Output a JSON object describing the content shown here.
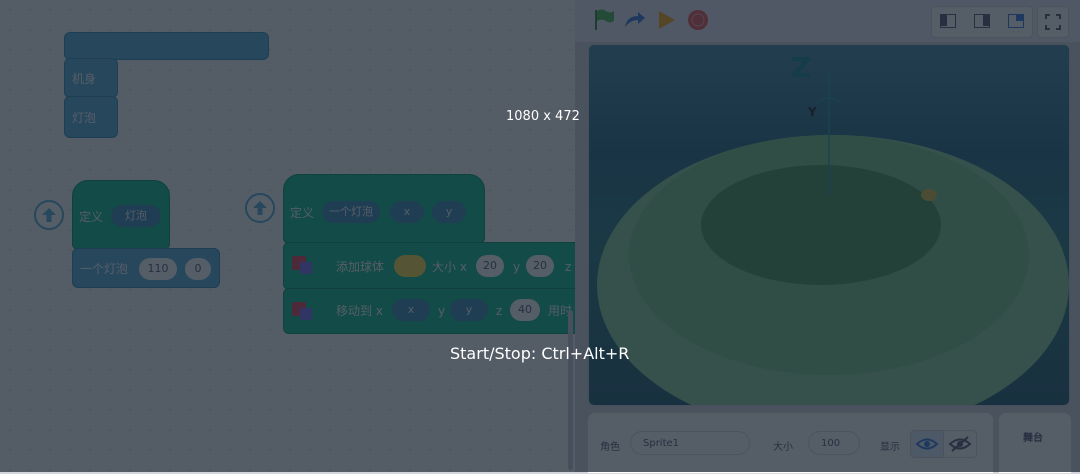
{
  "code_blocks": {
    "top_stack": {
      "item1": "机身",
      "item2": "灯泡"
    },
    "define_bulb": {
      "define_label": "定义",
      "name": "灯泡"
    },
    "call_block": {
      "label": "一个灯泡",
      "arg1": "110",
      "arg2": "0"
    },
    "define_one_bulb": {
      "define_label": "定义",
      "name": "一个灯泡",
      "param_x": "x",
      "param_y": "y"
    },
    "add_sphere": {
      "label": "添加球体",
      "size_label": "大小 x",
      "size_x": "20",
      "y_label": "y",
      "size_y": "20",
      "z_label": "z"
    },
    "move_to": {
      "label": "移动到 x",
      "x": "x",
      "y_label": "y",
      "y": "y",
      "z_label": "z",
      "z": "40",
      "time_label": "用时"
    }
  },
  "stage": {
    "axis_z": "Z",
    "axis_y": "Y"
  },
  "sprite_panel": {
    "sprite_label": "角色",
    "sprite_name": "Sprite1",
    "size_label": "大小",
    "size_value": "100",
    "show_label": "显示"
  },
  "stage_panel": {
    "label": "舞台"
  },
  "overlay": {
    "dimensions": "1080 x 472",
    "shortcut": "Start/Stop: Ctrl+Alt+R"
  },
  "colors": {
    "overlay": "#1e2d41",
    "block_blue": "#5cb1d6",
    "block_green": "#0fbd8c",
    "flag_green": "#4cbf56",
    "stop_red": "#ec5959"
  }
}
